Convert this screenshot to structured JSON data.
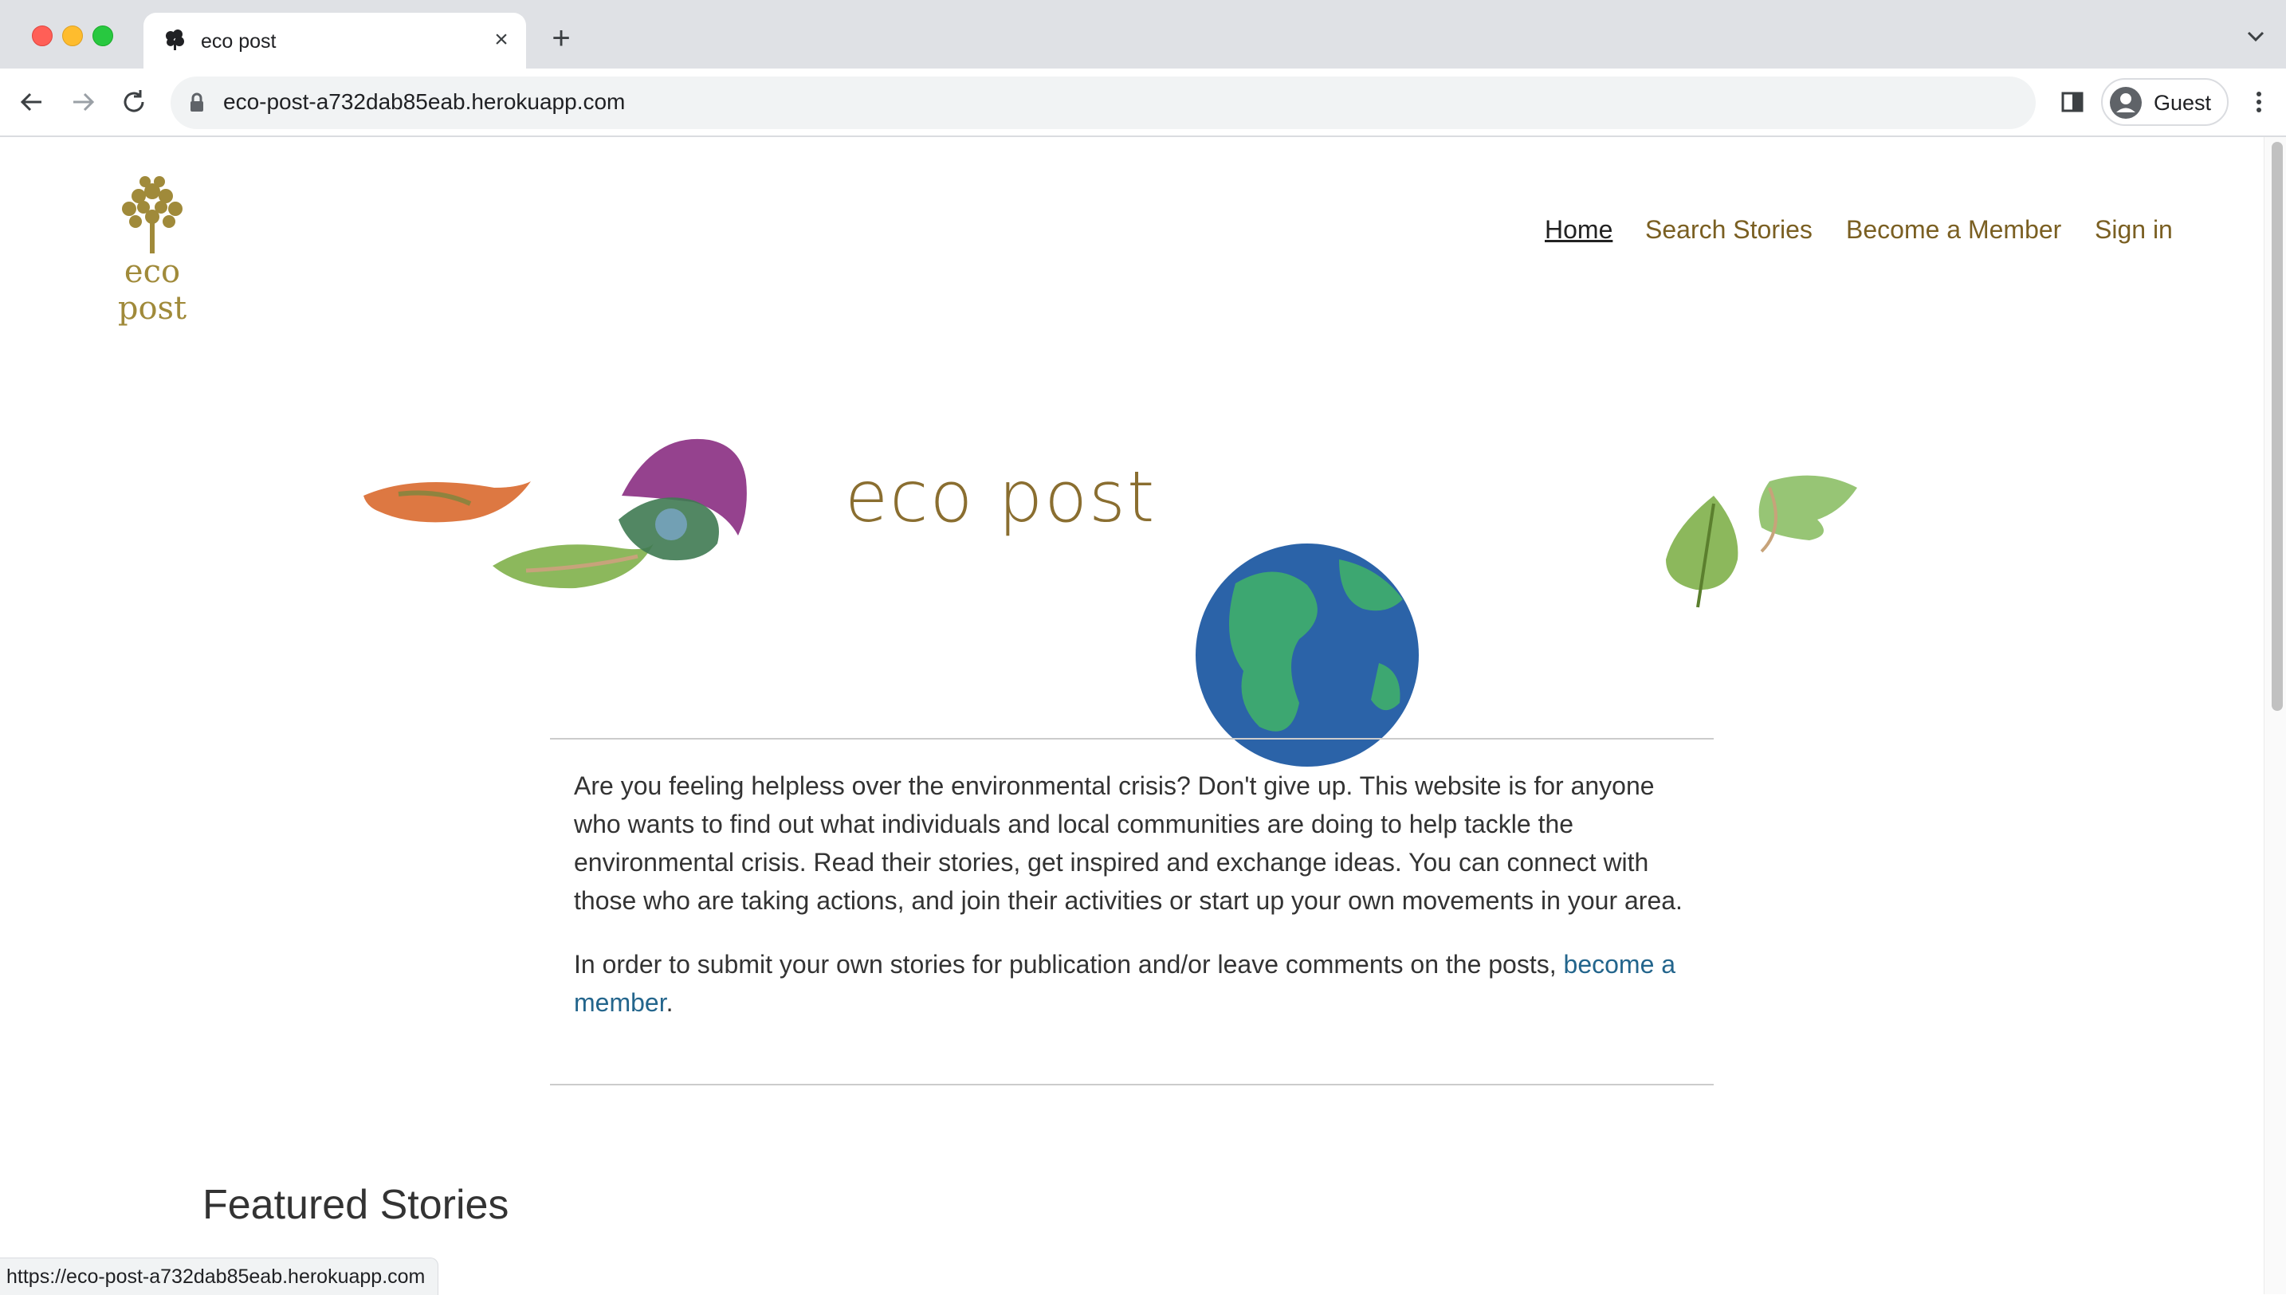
{
  "browser": {
    "tab_title": "eco post",
    "url": "eco-post-a732dab85eab.herokuapp.com",
    "profile_label": "Guest",
    "status_url": "https://eco-post-a732dab85eab.herokuapp.com"
  },
  "site": {
    "logo_text": "eco post",
    "nav": {
      "home": "Home",
      "search": "Search Stories",
      "member": "Become a Member",
      "signin": "Sign in"
    },
    "hero_title": "eco post",
    "intro": {
      "paragraph1": "Are you feeling helpless over the environmental crisis? Don't give up. This website is for anyone who wants to find out what individuals and local communities are doing to help tackle the environmental crisis. Read their stories, get inspired and exchange ideas. You can connect with those who are taking actions, and join their activities or start up your own movements in your area.",
      "paragraph2_prefix": "In order to submit your own stories for publication and/or leave comments on the posts, ",
      "paragraph2_link": "become a member",
      "paragraph2_suffix": "."
    },
    "featured_heading": "Featured Stories"
  },
  "colors": {
    "nav_link": "#7a5f22",
    "nav_active": "#222222",
    "brand_gold": "#a08a3a",
    "link_blue": "#23658c"
  }
}
